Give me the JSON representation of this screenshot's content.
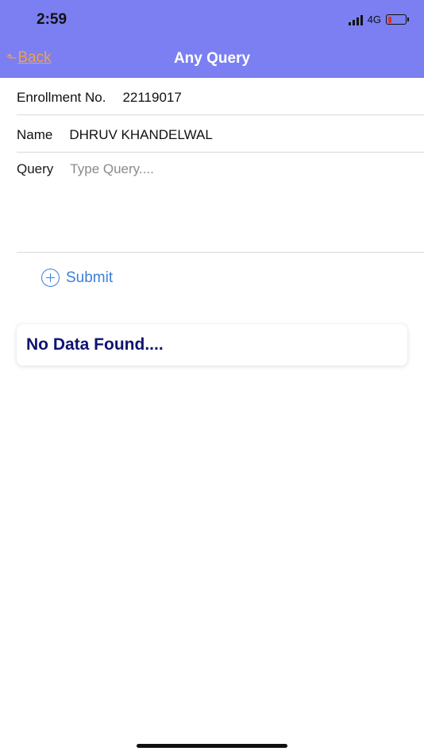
{
  "status_bar": {
    "time": "2:59",
    "network": "4G",
    "battery_level": 0.15,
    "battery_color": "#e0302b"
  },
  "nav": {
    "back_label": "Back",
    "back_icon": "back-arrow-icon",
    "title": "Any Query",
    "header_color": "#7b7ff2",
    "back_color": "#f2a044"
  },
  "form": {
    "enrollment_label": "Enrollment No.",
    "enrollment_value": "22119017",
    "name_label": "Name",
    "name_value": "DHRUV KHANDELWAL",
    "query_label": "Query",
    "query_value": "",
    "query_placeholder": "Type Query...."
  },
  "submit": {
    "icon": "plus-circle-icon",
    "label": "Submit",
    "color": "#3c7fd6"
  },
  "result": {
    "message": "No Data Found....",
    "color": "#0f1470"
  }
}
